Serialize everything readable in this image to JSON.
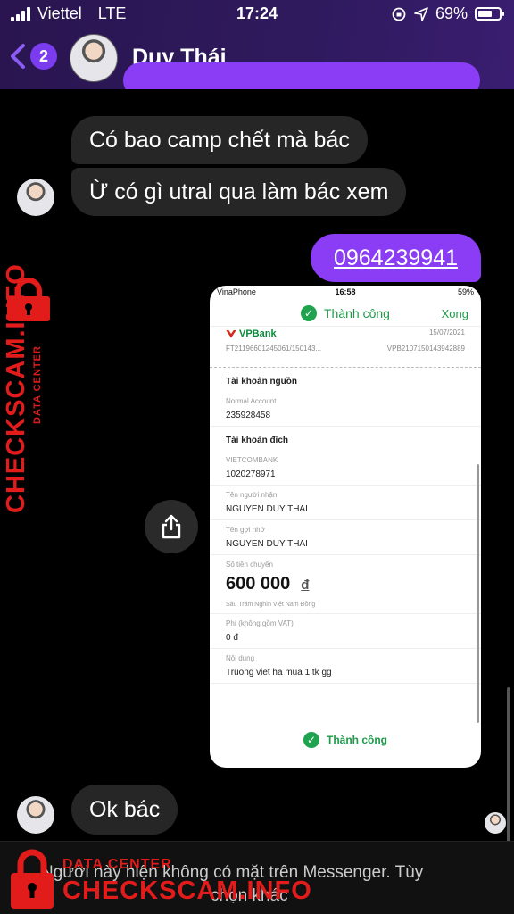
{
  "status_bar": {
    "carrier": "Viettel",
    "network": "LTE",
    "time": "17:24",
    "battery": "69%",
    "battery_level": 0.69
  },
  "header": {
    "back_count": "2",
    "contact_name": "Duy Thái"
  },
  "messages": {
    "m1": "Có bao camp chết mà bác",
    "m2": "Ừ có gì utral qua làm bác xem",
    "phone": "0964239941",
    "m3": "Ok bác"
  },
  "receipt": {
    "status": {
      "carrier": "VinaPhone",
      "time": "16:58",
      "battery": "59%"
    },
    "success": "Thành công",
    "done": "Xong",
    "bank": "VPBank",
    "date": "15/07/2021",
    "ref1": "FT21196601245061/150143...",
    "ref2": "VPB2107150143942889",
    "source_title": "Tài khoản nguồn",
    "source_label": "Normal Account",
    "source_value": "235928458",
    "dest_title": "Tài khoản đích",
    "dest_bank": "VIETCOMBANK",
    "dest_account": "1020278971",
    "recipient_label": "Tên người nhận",
    "recipient_value": "NGUYEN DUY THAI",
    "nickname_label": "Tên gợi nhớ",
    "nickname_value": "NGUYEN DUY THAI",
    "amount_label": "Số tiền chuyển",
    "amount_value": "600 000",
    "amount_currency": "đ",
    "amount_words": "Sáu Trăm Nghìn Việt Nam Đồng",
    "fee_label": "Phí (không gồm VAT)",
    "fee_value": "0 đ",
    "content_label": "Nội dung",
    "content_value": "Truong viet ha mua 1 tk gg",
    "footer_success": "Thành công"
  },
  "bottom": {
    "line1": "Người này hiện không có mặt trên Messenger. Tùy",
    "line2": "chọn khác"
  },
  "watermark": {
    "sub": "DATA CENTER",
    "main": "CHECKSCAM.INFO"
  },
  "colors": {
    "accent": "#8b3cf5",
    "bubble_in": "#262626",
    "success": "#1f9a4a",
    "watermark": "#e21b1b"
  }
}
